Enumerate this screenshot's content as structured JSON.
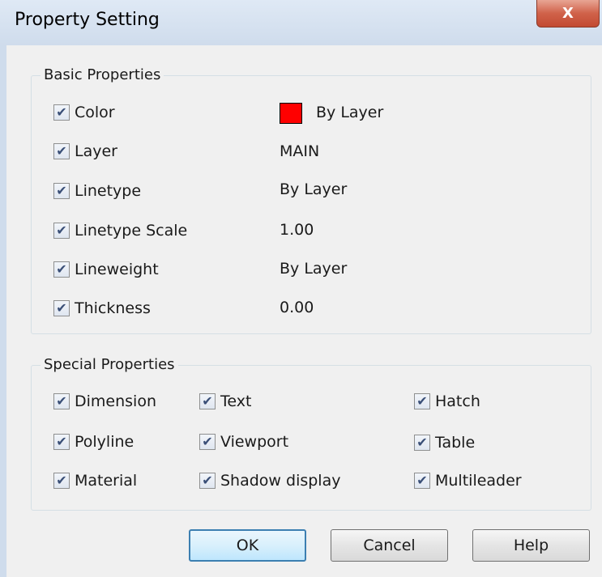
{
  "window": {
    "title": "Property Setting",
    "close_label": "X"
  },
  "basic": {
    "label": "Basic Properties",
    "color_hex": "#ff0000",
    "rows": [
      {
        "label": "Color",
        "value": "By Layer",
        "checked": true
      },
      {
        "label": "Layer",
        "value": "MAIN",
        "checked": true
      },
      {
        "label": "Linetype",
        "value": "By Layer",
        "checked": true
      },
      {
        "label": "Linetype Scale",
        "value": "1.00",
        "checked": true
      },
      {
        "label": "Lineweight",
        "value": "By Layer",
        "checked": true
      },
      {
        "label": "Thickness",
        "value": "0.00",
        "checked": true
      }
    ]
  },
  "special": {
    "label": "Special Properties",
    "items": [
      {
        "label": "Dimension",
        "checked": true
      },
      {
        "label": "Text",
        "checked": true
      },
      {
        "label": "Hatch",
        "checked": true
      },
      {
        "label": "Polyline",
        "checked": true
      },
      {
        "label": "Viewport",
        "checked": true
      },
      {
        "label": "Table",
        "checked": true
      },
      {
        "label": "Material",
        "checked": true
      },
      {
        "label": "Shadow display",
        "checked": true
      },
      {
        "label": "Multileader",
        "checked": true
      }
    ]
  },
  "buttons": {
    "ok": "OK",
    "cancel": "Cancel",
    "help": "Help"
  },
  "check_glyph": "✔"
}
